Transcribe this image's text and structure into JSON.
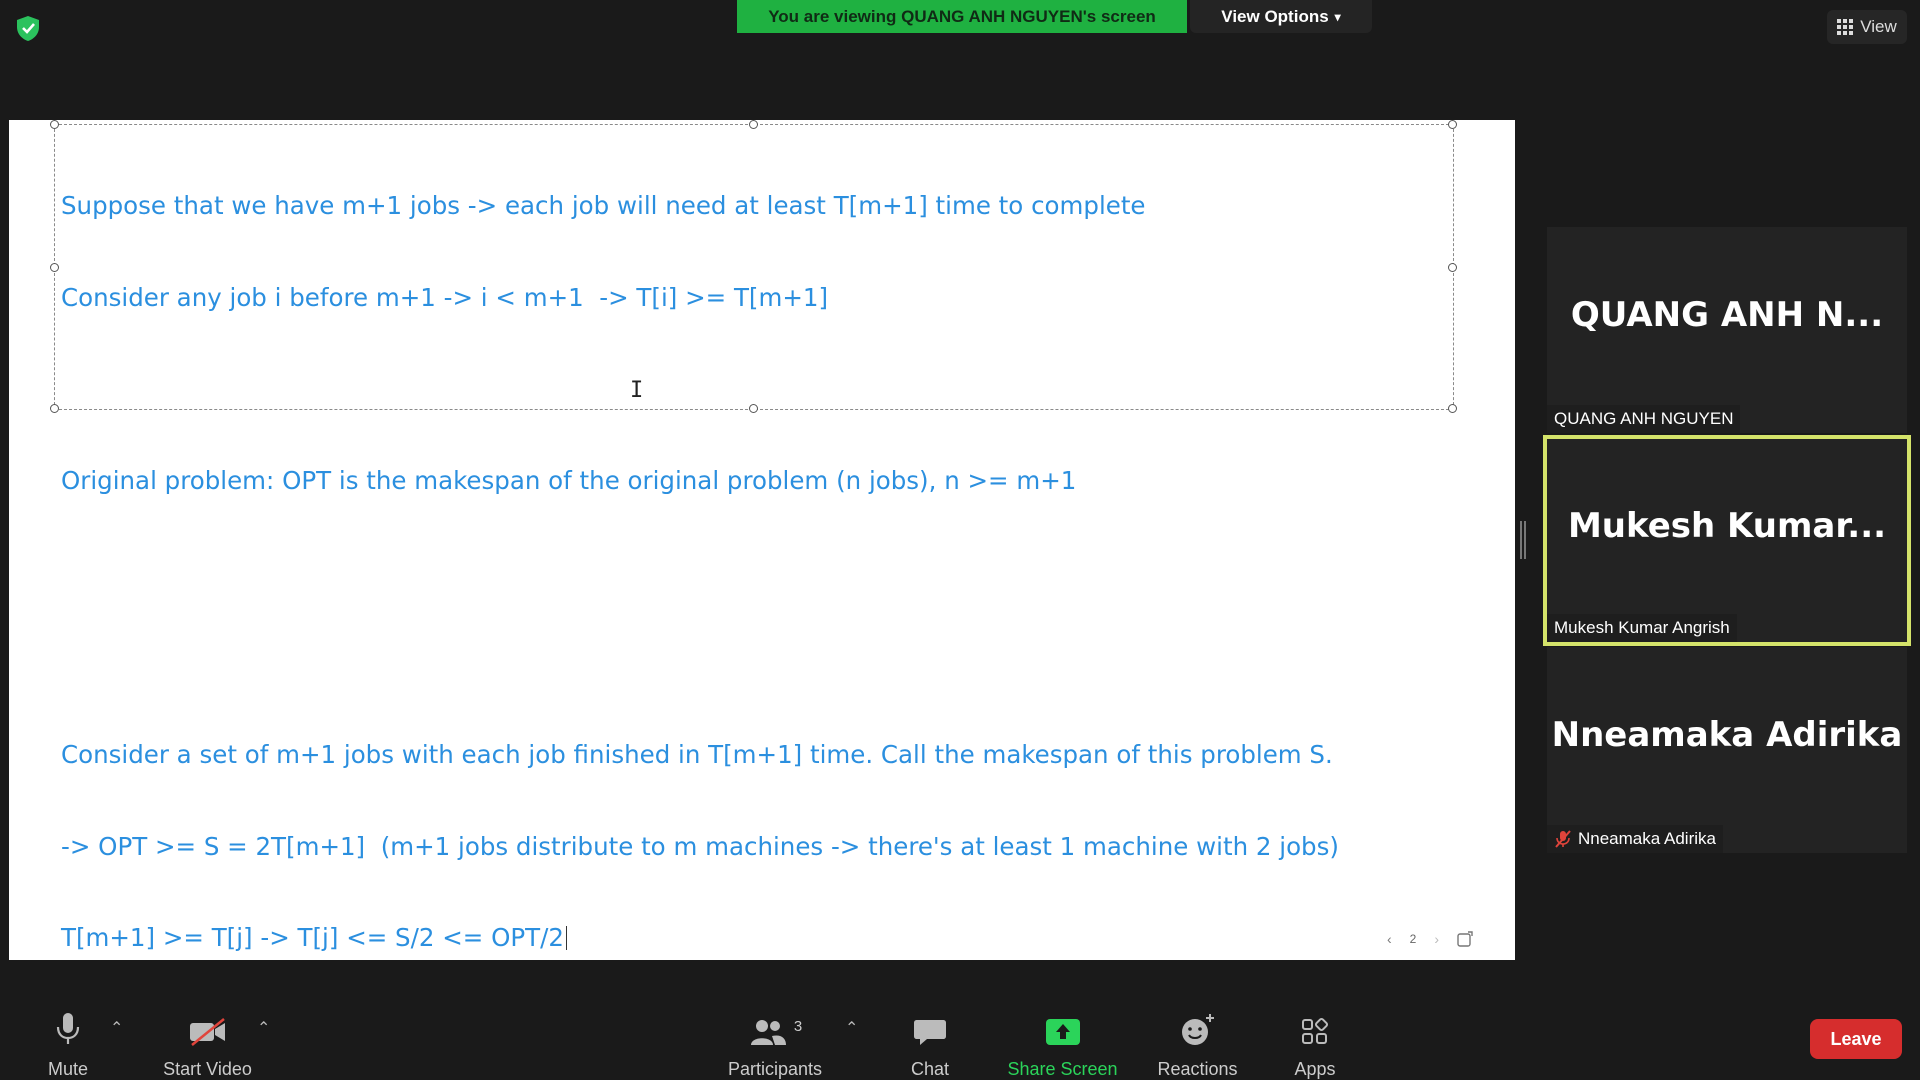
{
  "top_bar": {
    "viewing_banner": "You are viewing QUANG ANH NGUYEN's screen",
    "view_options": "View Options",
    "view_button": "View",
    "colors": {
      "banner_bg": "#1fb141",
      "shield": "#2bc25d"
    }
  },
  "shared_screen": {
    "lines": [
      "Suppose that we have m+1 jobs -> each job will need at least T[m+1] time to complete",
      "Consider any job i before m+1 -> i < m+1  -> T[i] >= T[m+1]",
      "",
      "Original problem: OPT is the makespan of the original problem (n jobs), n >= m+1",
      "",
      "",
      "Consider a set of m+1 jobs with each job finished in T[m+1] time. Call the makespan of this problem S.",
      "-> OPT >= S = 2T[m+1]  (m+1 jobs distribute to m machines -> there's at least 1 machine with 2 jobs)",
      "T[m+1] >= T[j] -> T[j] <= S/2 <= OPT/2"
    ],
    "text_color": "#2b8fdf",
    "page_number": "2"
  },
  "participants_panel": [
    {
      "display": "QUANG ANH N...",
      "name": "QUANG ANH NGUYEN",
      "active": false,
      "muted": false
    },
    {
      "display": "Mukesh  Kumar...",
      "name": "Mukesh Kumar Angrish",
      "active": true,
      "muted": false
    },
    {
      "display": "Nneamaka Adirika",
      "name": "Nneamaka Adirika",
      "active": false,
      "muted": true
    }
  ],
  "toolbar": {
    "mute": "Mute",
    "start_video": "Start Video",
    "participants": "Participants",
    "participant_count": "3",
    "chat": "Chat",
    "share_screen": "Share Screen",
    "reactions": "Reactions",
    "apps": "Apps",
    "leave": "Leave",
    "colors": {
      "share": "#2bd45a",
      "leave": "#d62d2d",
      "active_tile": "#d4e36a"
    }
  }
}
